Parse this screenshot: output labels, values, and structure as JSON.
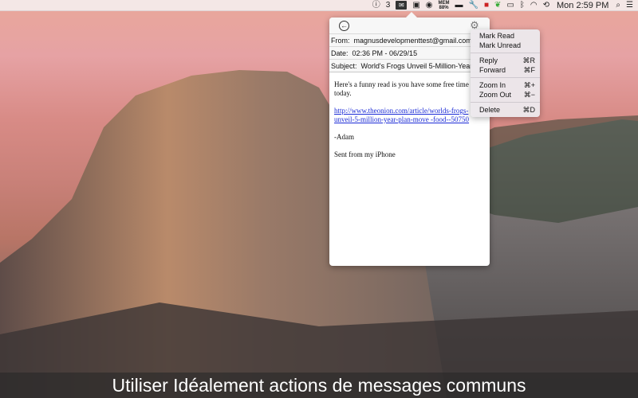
{
  "menubar": {
    "mail_count": "3",
    "battery_label": "MEM",
    "battery_value": "88%",
    "clock": "Mon 2:59 PM"
  },
  "popover": {
    "from_label": "From:",
    "from_value": "magnusdevelopmenttest@gmail.com",
    "date_label": "Date:",
    "date_value": "02:36 PM - 06/29/15",
    "subject_label": "Subject:",
    "subject_value": "World's Frogs Unveil 5-Million-Year",
    "body": {
      "line1": "Here's a funny read is you have some free time today.",
      "link": "http://www.theonion.com/article/worlds-frogs-unveil-5-million-year-plan-move -food--50750",
      "signoff": "-Adam",
      "footer": "Sent from my iPhone"
    }
  },
  "menu": {
    "mark_read": "Mark Read",
    "mark_unread": "Mark Unread",
    "reply": "Reply",
    "reply_shortcut": "⌘R",
    "forward": "Forward",
    "forward_shortcut": "⌘F",
    "zoom_in": "Zoom In",
    "zoom_in_shortcut": "⌘+",
    "zoom_out": "Zoom Out",
    "zoom_out_shortcut": "⌘−",
    "delete": "Delete",
    "delete_shortcut": "⌘D"
  },
  "caption": "Utiliser Idéalement actions de messages communs"
}
